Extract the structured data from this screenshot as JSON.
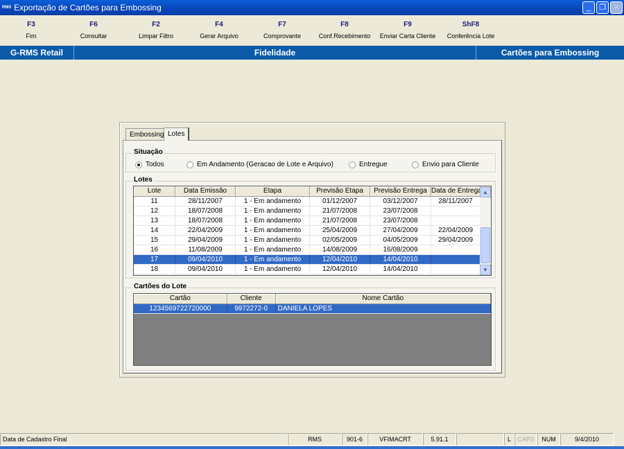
{
  "window": {
    "title": "Exportação de Cartões para Embossing",
    "icon": "rms-app-icon",
    "min": "minimize-icon",
    "max": "restore-icon",
    "close": "close-icon"
  },
  "toolbar": [
    {
      "key": "F3",
      "label": "Fim"
    },
    {
      "key": "F6",
      "label": "Consultar"
    },
    {
      "key": "F2",
      "label": "Limpar Filtro"
    },
    {
      "key": "F4",
      "label": "Gerar Arquivo"
    },
    {
      "key": "F7",
      "label": "Comprovante"
    },
    {
      "key": "F8",
      "label": "Conf.Recebimento"
    },
    {
      "key": "F9",
      "label": "Enviar Carta Cliente"
    },
    {
      "key": "ShF8",
      "label": "Conferência Lote"
    }
  ],
  "header": {
    "left": "G-RMS Retail",
    "center": "Fidelidade",
    "right": "Cartões para Embossing"
  },
  "tabs": [
    {
      "label": "Embossing"
    },
    {
      "label": "Lotes",
      "active": true
    }
  ],
  "situacao": {
    "title": "Situação",
    "options": [
      {
        "label": "Todos",
        "checked": true
      },
      {
        "label": "Em Andamento (Geracao de Lote e Arquivo)"
      },
      {
        "label": "Entregue"
      },
      {
        "label": "Envio para Cliente"
      }
    ]
  },
  "lotes": {
    "title": "Lotes",
    "columns": [
      "Lote",
      "Data Emissão",
      "Etapa",
      "Previsão Etapa",
      "Previsão Entrega",
      "Data de Entrega"
    ],
    "rows": [
      [
        "11",
        "28/11/2007",
        "1 - Em andamento",
        "01/12/2007",
        "03/12/2007",
        "28/11/2007"
      ],
      [
        "12",
        "18/07/2008",
        "1 - Em andamento",
        "21/07/2008",
        "23/07/2008",
        ""
      ],
      [
        "13",
        "18/07/2008",
        "1 - Em andamento",
        "21/07/2008",
        "23/07/2008",
        ""
      ],
      [
        "14",
        "22/04/2009",
        "1 - Em andamento",
        "25/04/2009",
        "27/04/2009",
        "22/04/2009"
      ],
      [
        "15",
        "29/04/2009",
        "1 - Em andamento",
        "02/05/2009",
        "04/05/2009",
        "29/04/2009"
      ],
      [
        "16",
        "11/08/2009",
        "1 - Em andamento",
        "14/08/2009",
        "16/08/2009",
        ""
      ],
      [
        "17",
        "09/04/2010",
        "1 - Em andamento",
        "12/04/2010",
        "14/04/2010",
        ""
      ],
      [
        "18",
        "09/04/2010",
        "1 - Em andamento",
        "12/04/2010",
        "14/04/2010",
        ""
      ]
    ],
    "selected_index": 6
  },
  "cartoes": {
    "title": "Cartões do Lote",
    "columns": [
      "Cartão",
      "Cliente",
      "Nome Cartão"
    ],
    "rows": [
      [
        "1234569722720000",
        "9972272-0",
        "DANIELA LOPES"
      ]
    ]
  },
  "status": {
    "message": "Data de Cadastro Final",
    "cells": [
      "RMS",
      "901-6",
      "VFIMACRT",
      "5.91.1",
      "",
      "L",
      "CAPS",
      "NUM",
      "9/4/2010"
    ]
  },
  "colors": {
    "titlebar": "#0a5fd8",
    "header": "#0b5aa8",
    "selection": "#316ac5",
    "background": "#ece9d8"
  }
}
